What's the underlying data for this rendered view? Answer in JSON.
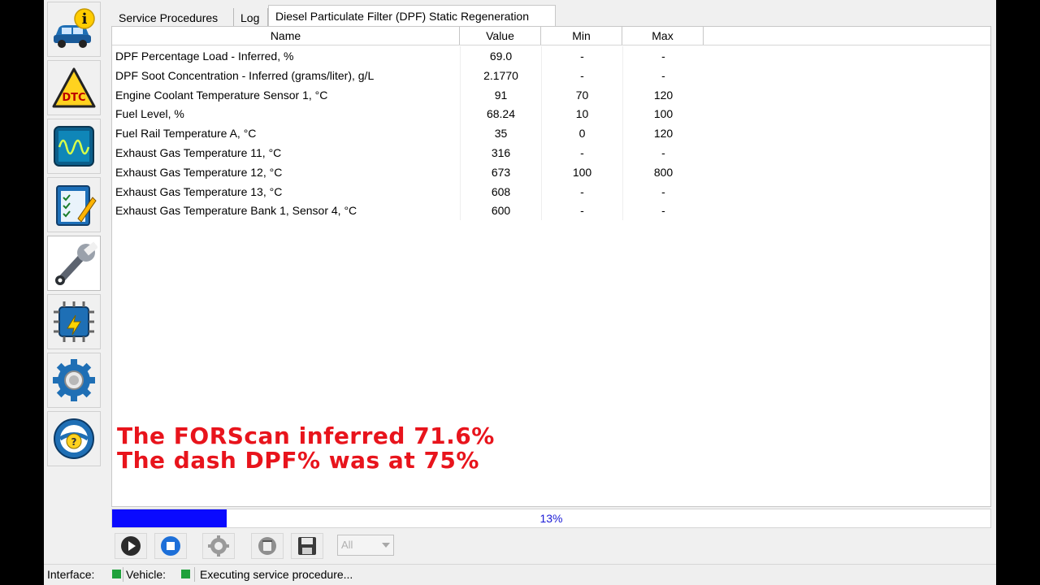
{
  "tabs": [
    {
      "label": "Service Procedures"
    },
    {
      "label": "Log"
    },
    {
      "label": "Diesel Particulate Filter (DPF) Static Regeneration"
    }
  ],
  "sidebar": {
    "items": [
      {
        "icon": "vehicle-info-icon"
      },
      {
        "icon": "dtc-icon"
      },
      {
        "icon": "oscilloscope-icon"
      },
      {
        "icon": "checklist-icon"
      },
      {
        "icon": "wrench-icon",
        "active": true
      },
      {
        "icon": "module-config-icon"
      },
      {
        "icon": "settings-gear-icon"
      },
      {
        "icon": "help-icon"
      }
    ]
  },
  "table": {
    "headers": {
      "name": "Name",
      "value": "Value",
      "min": "Min",
      "max": "Max"
    },
    "rows": [
      {
        "name": "DPF Percentage Load - Inferred, %",
        "value": "69.0",
        "min": "-",
        "max": "-"
      },
      {
        "name": "DPF Soot Concentration - Inferred (grams/liter), g/L",
        "value": "2.1770",
        "min": "-",
        "max": "-"
      },
      {
        "name": "Engine Coolant Temperature Sensor 1, °C",
        "value": "91",
        "min": "70",
        "max": "120"
      },
      {
        "name": "Fuel Level, %",
        "value": "68.24",
        "min": "10",
        "max": "100"
      },
      {
        "name": "Fuel Rail Temperature A, °C",
        "value": "35",
        "min": "0",
        "max": "120"
      },
      {
        "name": "Exhaust Gas Temperature 11, °C",
        "value": "316",
        "min": "-",
        "max": "-"
      },
      {
        "name": "Exhaust Gas Temperature 12, °C",
        "value": "673",
        "min": "100",
        "max": "800"
      },
      {
        "name": "Exhaust Gas Temperature 13, °C",
        "value": "608",
        "min": "-",
        "max": "-"
      },
      {
        "name": "Exhaust Gas Temperature Bank 1, Sensor 4, °C",
        "value": "600",
        "min": "-",
        "max": "-"
      }
    ]
  },
  "caption": {
    "line1": "The FORScan inferred 71.6%",
    "line2": "The dash DPF% was at 75%"
  },
  "progress": {
    "value": 0.13,
    "label": "13%",
    "color": "#0a0aff"
  },
  "toolbar": {
    "buttons": [
      {
        "icon": "play-icon"
      },
      {
        "icon": "stop-icon"
      },
      {
        "icon": "settings-icon"
      },
      {
        "icon": "clear-icon"
      },
      {
        "icon": "save-icon"
      }
    ],
    "filter_value": "All"
  },
  "status": {
    "interface_label": "Interface:",
    "vehicle_label": "Vehicle:",
    "message": "Executing service procedure...",
    "ok_color": "#1fa13b"
  }
}
